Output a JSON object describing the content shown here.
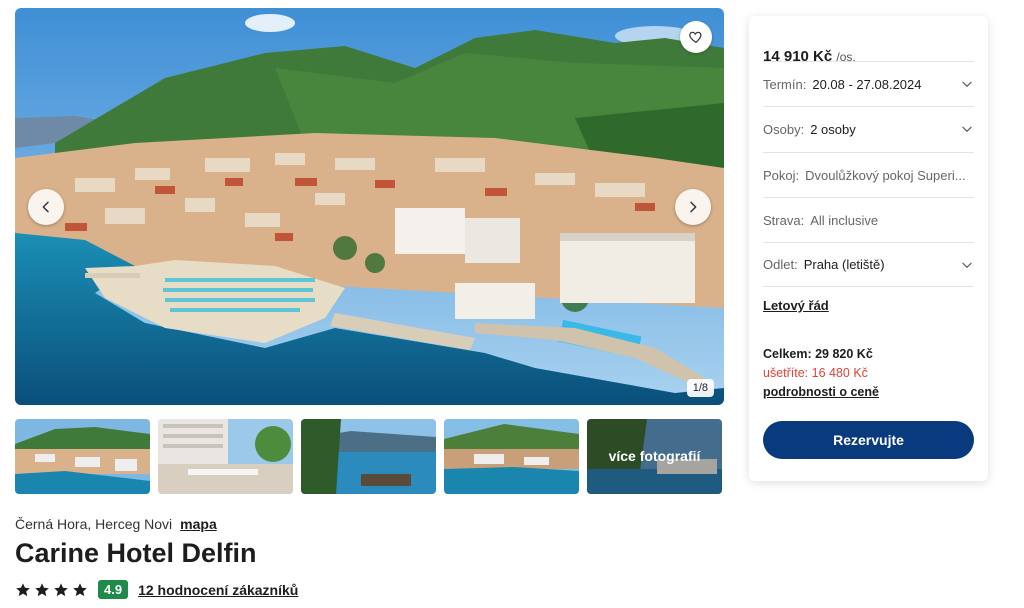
{
  "gallery": {
    "counter": "1/8",
    "thumbnails_more_label": "více fotografií",
    "heart_icon": "heart-outline-icon",
    "prev_icon": "chevron-left-icon",
    "next_icon": "chevron-right-icon"
  },
  "hotel": {
    "location": "Černá Hora, Herceg Novi",
    "map_link": "mapa",
    "name": "Carine Hotel Delfin",
    "stars": 4,
    "rating": "4.9",
    "reviews_link": "12 hodnocení zákazníků"
  },
  "booking": {
    "price": "14 910 Kč",
    "price_unit": "/os.",
    "options": [
      {
        "label": "Termín:",
        "value": "20.08 - 27.08.2024",
        "dropdown": true
      },
      {
        "label": "Osoby:",
        "value": "2 osoby",
        "dropdown": true
      },
      {
        "label": "Pokoj:",
        "value": "Dvoulůžkový pokoj Superi...",
        "dropdown": false
      },
      {
        "label": "Strava:",
        "value": "All inclusive",
        "dropdown": false
      },
      {
        "label": "Odlet:",
        "value": "Praha (letiště)",
        "dropdown": true
      }
    ],
    "flight_link": "Letový řád",
    "total": "Celkem: 29 820 Kč",
    "savings": "ušetříte: 16 480 Kč",
    "price_details_link": "podrobnosti o ceně",
    "reserve_button": "Rezervujte"
  },
  "colors": {
    "primary_button": "#0a3a7e",
    "rating_badge": "#1f8a4c",
    "savings_text": "#e0433a",
    "sea": "#0f7fa6"
  }
}
